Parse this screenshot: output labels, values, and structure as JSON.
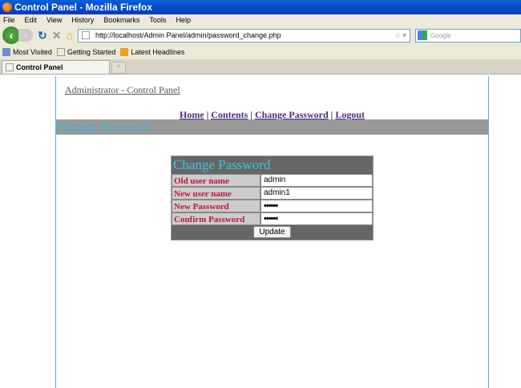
{
  "window": {
    "title": "Control Panel - Mozilla Firefox"
  },
  "menu": [
    "File",
    "Edit",
    "View",
    "History",
    "Bookmarks",
    "Tools",
    "Help"
  ],
  "url": "http://localhost/Admin Panel/admin/password_change.php",
  "search_placeholder": "Google",
  "bookmarks": [
    "Most Visited",
    "Getting Started",
    "Latest Headlines"
  ],
  "tab": {
    "label": "Control Panel",
    "new_tab": "+"
  },
  "page": {
    "admin_title": "Administrator - Control Panel",
    "nav": [
      "Home",
      "Contents",
      "Change Password",
      "Logout"
    ],
    "separator": "|",
    "section_title": "Manage Password",
    "form": {
      "title": "Change Password",
      "fields": [
        {
          "label": "Old user name",
          "value": "admin"
        },
        {
          "label": "New user name",
          "value": "admin1"
        },
        {
          "label": "New Password",
          "value": "••••••"
        },
        {
          "label": "Confirm Password",
          "value": "••••••"
        }
      ],
      "button": "Update"
    }
  }
}
